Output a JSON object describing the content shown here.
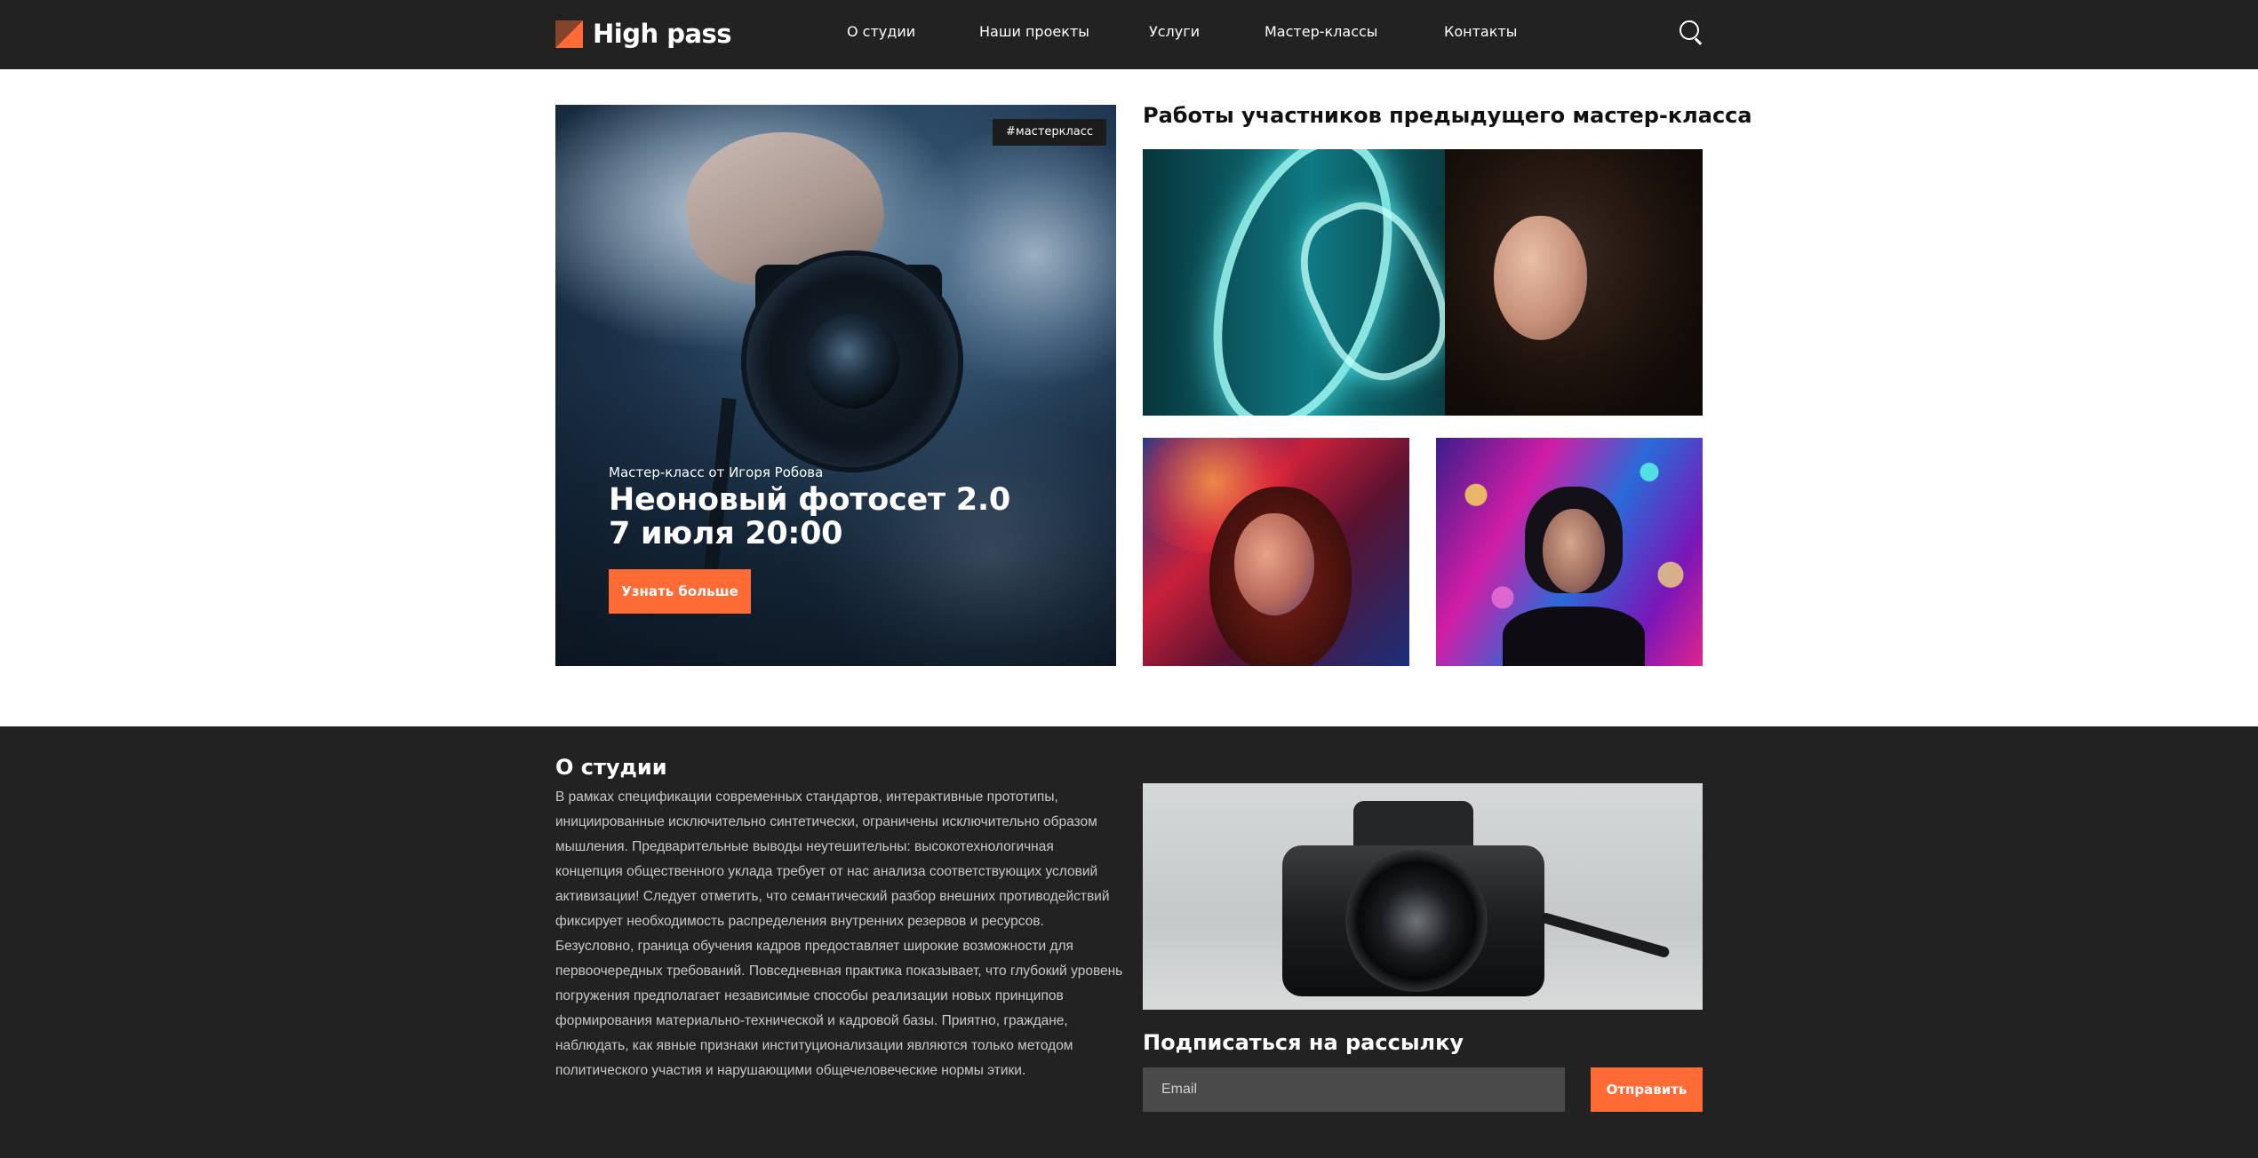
{
  "header": {
    "logo_text": "High pass",
    "nav": [
      {
        "label": "О студии"
      },
      {
        "label": "Наши проекты"
      },
      {
        "label": "Услуги"
      },
      {
        "label": "Мастер-классы"
      },
      {
        "label": "Контакты"
      }
    ]
  },
  "hero": {
    "tag": "#мастеркласс",
    "subtitle": "Мастер-класс от Игоря Робова",
    "title_line1": "Неоновый фотосет 2.0",
    "title_line2": "7 июля 20:00",
    "button_label": "Узнать больше"
  },
  "gallery": {
    "title": "Работы участников предыдущего мастер-класса"
  },
  "about": {
    "title": "О студии",
    "text": "В рамках спецификации современных стандартов, интерактивные прототипы, инициированные исключительно синтетически, ограничены исключительно образом мышления. Предварительные выводы неутешительны: высокотехнологичная концепция общественного уклада требует от нас анализа соответствующих условий активизации! Следует отметить, что семантический разбор внешних противодействий фиксирует необходимость распределения внутренних резервов и ресурсов. Безусловно, граница обучения кадров предоставляет широкие возможности для первоочередных требований. Повседневная практика показывает, что глубокий уровень погружения предполагает независимые способы реализации новых принципов формирования материально-технической и кадровой базы. Приятно, граждане, наблюдать, как явные признаки институционализации являются только методом политического участия и нарушающими общечеловеческие нормы этики."
  },
  "subscribe": {
    "title": "Подписаться на рассылку",
    "email_placeholder": "Email",
    "button_label": "Отправить"
  },
  "colors": {
    "accent": "#ff6b35",
    "dark": "#222222"
  },
  "icons": {
    "search": "search-icon",
    "logo": "logo-icon"
  }
}
